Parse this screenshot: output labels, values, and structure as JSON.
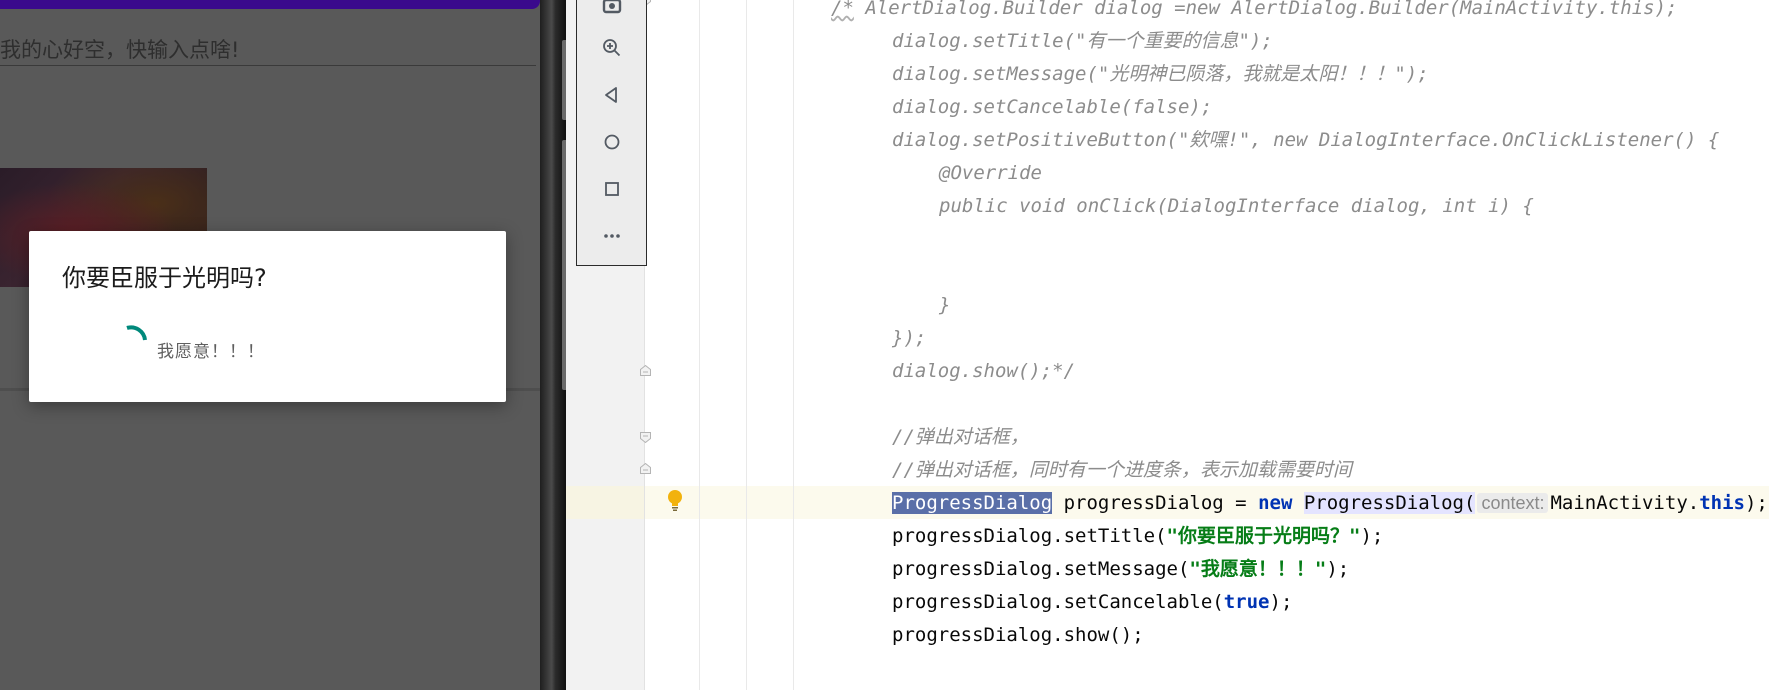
{
  "emulator": {
    "edit_text_hint": "我的心好空，快输入点啥!",
    "dialog": {
      "title": "你要臣服于光明吗?",
      "message": "我愿意！！！"
    },
    "toolbar_icons": [
      "camera-icon",
      "zoom-icon",
      "back-icon",
      "home-icon",
      "overview-icon",
      "more-icon"
    ]
  },
  "editor": {
    "lines": [
      {
        "segments": [
          {
            "t": "/*",
            "c": "cmt squiggle"
          },
          {
            "t": " AlertDialog.Builder dialog =new AlertDialog.Builder(MainActivity.this);",
            "c": "cmt"
          }
        ],
        "indent": 0
      },
      {
        "segments": [
          {
            "t": "dialog.setTitle(\"有一个重要的信息\");",
            "c": "cmt"
          }
        ],
        "indent": 1
      },
      {
        "segments": [
          {
            "t": "dialog.setMessage(\"光明神已陨落，我就是太阳！！！\");",
            "c": "cmt"
          }
        ],
        "indent": 1
      },
      {
        "segments": [
          {
            "t": "dialog.setCancelable(false);",
            "c": "cmt"
          }
        ],
        "indent": 1
      },
      {
        "segments": [
          {
            "t": "dialog.setPositiveButton(\"欸嘿!\", new DialogInterface.OnClickListener() {",
            "c": "cmt"
          }
        ],
        "indent": 1
      },
      {
        "segments": [
          {
            "t": "@Override",
            "c": "cmt"
          }
        ],
        "indent": 2
      },
      {
        "segments": [
          {
            "t": "public void onClick(DialogInterface dialog, int i) {",
            "c": "cmt"
          }
        ],
        "indent": 2
      },
      {
        "segments": [],
        "indent": 0
      },
      {
        "segments": [],
        "indent": 0
      },
      {
        "segments": [
          {
            "t": "}",
            "c": "cmt"
          }
        ],
        "indent": 2
      },
      {
        "segments": [
          {
            "t": "});",
            "c": "cmt"
          }
        ],
        "indent": 1
      },
      {
        "segments": [
          {
            "t": "dialog.show();*/",
            "c": "cmt"
          }
        ],
        "indent": 1
      },
      {
        "segments": [],
        "indent": 0
      },
      {
        "segments": [
          {
            "t": "//弹出对话框，",
            "c": "cmt"
          }
        ],
        "indent": 1
      },
      {
        "segments": [
          {
            "t": "//弹出对话框，同时有一个进度条，表示加载需要时间",
            "c": "cmt"
          }
        ],
        "indent": 1
      },
      {
        "segments": [
          {
            "t": "ProgressDialog",
            "c": "sel"
          },
          {
            "t": " progressDialog = ",
            "c": ""
          },
          {
            "t": "new",
            "c": "kw"
          },
          {
            "t": " ",
            "c": ""
          },
          {
            "t": "ProgressDialog(",
            "c": "hl"
          },
          {
            "t": "context:",
            "c": "hint"
          },
          {
            "t": "MainActivity.",
            "c": ""
          },
          {
            "t": "this",
            "c": "kw"
          },
          {
            "t": ");",
            "c": ""
          }
        ],
        "indent": 1
      },
      {
        "segments": [
          {
            "t": "progressDialog.setTitle(",
            "c": ""
          },
          {
            "t": "\"你要臣服于光明吗？\"",
            "c": "str"
          },
          {
            "t": ");",
            "c": ""
          }
        ],
        "indent": 1
      },
      {
        "segments": [
          {
            "t": "progressDialog.setMessage(",
            "c": ""
          },
          {
            "t": "\"我愿意！！！\"",
            "c": "str"
          },
          {
            "t": ");",
            "c": ""
          }
        ],
        "indent": 1
      },
      {
        "segments": [
          {
            "t": "progressDialog.setCancelable(",
            "c": ""
          },
          {
            "t": "true",
            "c": "kw"
          },
          {
            "t": ");",
            "c": ""
          }
        ],
        "indent": 1
      },
      {
        "segments": [
          {
            "t": "progressDialog.show();",
            "c": ""
          }
        ],
        "indent": 1
      }
    ]
  },
  "colors": {
    "app_bar": "#3a0a8c",
    "spinner": "#00897b",
    "comment": "#8c8c8c",
    "keyword": "#0033b3",
    "string": "#067d17",
    "selection": "#5a6fa8"
  }
}
